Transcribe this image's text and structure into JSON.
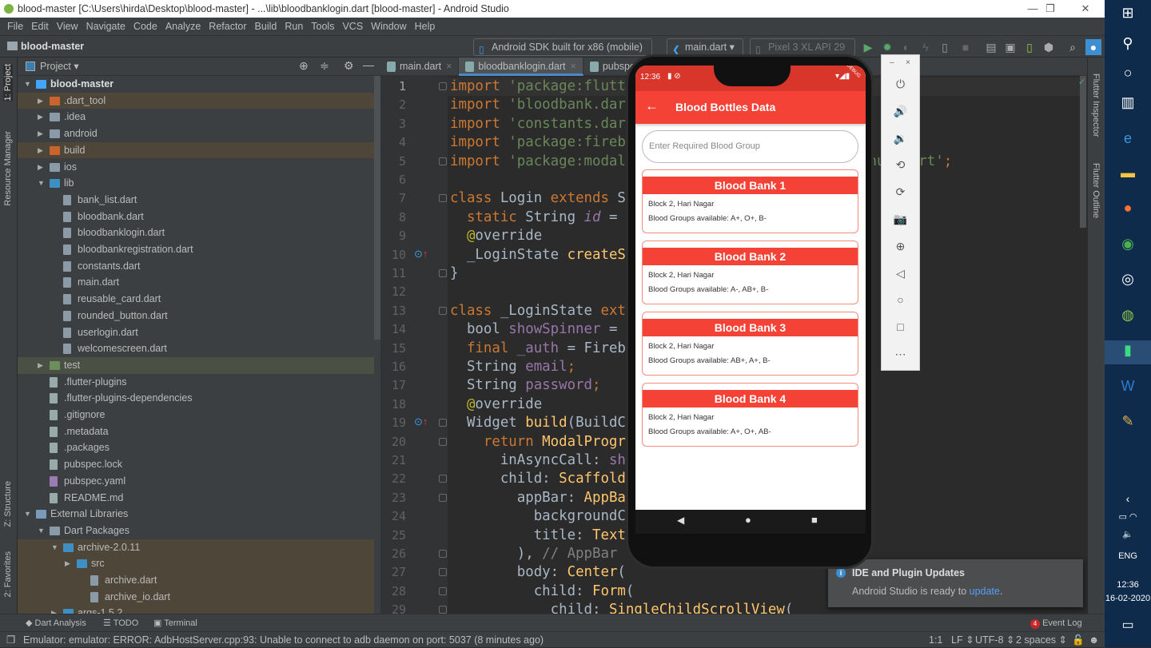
{
  "window": {
    "title": "blood-master [C:\\Users\\hirda\\Desktop\\blood-master] - ...\\lib\\bloodbanklogin.dart [blood-master] - Android Studio",
    "controls": [
      "—",
      "❐",
      "✕"
    ]
  },
  "menu": [
    "File",
    "Edit",
    "View",
    "Navigate",
    "Code",
    "Analyze",
    "Refactor",
    "Build",
    "Run",
    "Tools",
    "VCS",
    "Window",
    "Help"
  ],
  "nav": {
    "project": "blood-master",
    "device": "Android SDK built for x86 (mobile)",
    "run_config": "main.dart",
    "avd": "Pixel 3 XL API 29"
  },
  "left_stripe": [
    "1: Project",
    "Resource Manager",
    "Z: Structure",
    "2: Favorites"
  ],
  "right_stripe": [
    "Flutter Inspector",
    "Flutter Outline"
  ],
  "project_panel": {
    "title": "Project",
    "root_path": "C:\\Users\\hirda\\Desktop\\blood-master",
    "tree": [
      {
        "label": "blood-master",
        "indent": 0,
        "expanded": true,
        "icon": "flutter-module"
      },
      {
        "label": ".dart_tool",
        "indent": 1,
        "expanded": false,
        "icon": "folder-excluded",
        "hl": "brown"
      },
      {
        "label": ".idea",
        "indent": 1,
        "expanded": false,
        "icon": "folder-config"
      },
      {
        "label": "android",
        "indent": 1,
        "expanded": false,
        "icon": "folder-module"
      },
      {
        "label": "build",
        "indent": 1,
        "expanded": false,
        "icon": "folder-excluded",
        "hl": "brown"
      },
      {
        "label": "ios",
        "indent": 1,
        "expanded": false,
        "icon": "folder-module"
      },
      {
        "label": "lib",
        "indent": 1,
        "expanded": true,
        "icon": "folder-source"
      },
      {
        "label": "bank_list.dart",
        "indent": 2,
        "icon": "dart-file"
      },
      {
        "label": "bloodbank.dart",
        "indent": 2,
        "icon": "dart-file"
      },
      {
        "label": "bloodbanklogin.dart",
        "indent": 2,
        "icon": "dart-file"
      },
      {
        "label": "bloodbankregistration.dart",
        "indent": 2,
        "icon": "dart-file"
      },
      {
        "label": "constants.dart",
        "indent": 2,
        "icon": "dart-file"
      },
      {
        "label": "main.dart",
        "indent": 2,
        "icon": "dart-file"
      },
      {
        "label": "reusable_card.dart",
        "indent": 2,
        "icon": "dart-file"
      },
      {
        "label": "rounded_button.dart",
        "indent": 2,
        "icon": "dart-file"
      },
      {
        "label": "userlogin.dart",
        "indent": 2,
        "icon": "dart-file"
      },
      {
        "label": "welcomescreen.dart",
        "indent": 2,
        "icon": "dart-file"
      },
      {
        "label": "test",
        "indent": 1,
        "expanded": false,
        "icon": "folder-test",
        "hl": "green"
      },
      {
        "label": ".flutter-plugins",
        "indent": 1,
        "icon": "file"
      },
      {
        "label": ".flutter-plugins-dependencies",
        "indent": 1,
        "icon": "file"
      },
      {
        "label": ".gitignore",
        "indent": 1,
        "icon": "file"
      },
      {
        "label": ".metadata",
        "indent": 1,
        "icon": "file"
      },
      {
        "label": ".packages",
        "indent": 1,
        "icon": "file"
      },
      {
        "label": "pubspec.lock",
        "indent": 1,
        "icon": "file"
      },
      {
        "label": "pubspec.yaml",
        "indent": 1,
        "icon": "yaml-file"
      },
      {
        "label": "README.md",
        "indent": 1,
        "icon": "file"
      },
      {
        "label": "External Libraries",
        "indent": 0,
        "expanded": true,
        "icon": "library"
      },
      {
        "label": "Dart Packages",
        "indent": 1,
        "expanded": true,
        "icon": "folder"
      },
      {
        "label": "archive-2.0.11",
        "indent": 2,
        "expanded": true,
        "icon": "folder-source",
        "hl": "brown"
      },
      {
        "label": "src",
        "indent": 3,
        "expanded": false,
        "icon": "folder-source",
        "hl": "brown"
      },
      {
        "label": "archive.dart",
        "indent": 4,
        "icon": "dart-file",
        "hl": "brown"
      },
      {
        "label": "archive_io.dart",
        "indent": 4,
        "icon": "dart-file",
        "hl": "brown"
      },
      {
        "label": "args-1.5.2",
        "indent": 2,
        "expanded": false,
        "icon": "folder-source",
        "hl": "brown"
      }
    ]
  },
  "editor": {
    "tabs": [
      {
        "label": "main.dart",
        "active": false
      },
      {
        "label": "bloodbanklogin.dart",
        "active": true
      },
      {
        "label": "pubspec.yaml",
        "active": false
      }
    ],
    "current_line": 1,
    "lines": [
      [
        [
          "import ",
          "k"
        ],
        [
          "'package:flutt",
          "s"
        ]
      ],
      [
        [
          "import ",
          "k"
        ],
        [
          "'bloodbank.dar",
          "s"
        ]
      ],
      [
        [
          "import ",
          "k"
        ],
        [
          "'constants.dar",
          "s"
        ]
      ],
      [
        [
          "import ",
          "k"
        ],
        [
          "'package:fireb",
          "s"
        ]
      ],
      [
        [
          "import ",
          "k"
        ],
        [
          "'package:modal_progress_hud/modal_progress_hud.dart'",
          "s"
        ],
        [
          ";",
          "k"
        ]
      ],
      [],
      [
        [
          "class ",
          "k"
        ],
        [
          "Login ",
          "d"
        ],
        [
          "extends ",
          "k"
        ],
        [
          "S",
          "d"
        ]
      ],
      [
        [
          "  static ",
          "k"
        ],
        [
          "String ",
          "d"
        ],
        [
          "id",
          "fi2"
        ],
        [
          " =",
          "d"
        ]
      ],
      [
        [
          "  @",
          "a"
        ],
        [
          "override",
          "d"
        ]
      ],
      [
        [
          "  _LoginState ",
          "d"
        ],
        [
          "createS",
          "fn"
        ]
      ],
      [
        [
          "}",
          "d"
        ]
      ],
      [],
      [
        [
          "class ",
          "k"
        ],
        [
          "_LoginState ",
          "d"
        ],
        [
          "ext",
          "k"
        ]
      ],
      [
        [
          "  bool ",
          "d"
        ],
        [
          "showSpinner",
          "f"
        ],
        [
          " =",
          "d"
        ]
      ],
      [
        [
          "  final ",
          "k"
        ],
        [
          "_auth",
          "f"
        ],
        [
          " = Fireb",
          "d"
        ]
      ],
      [
        [
          "  String ",
          "d"
        ],
        [
          "email",
          "f"
        ],
        [
          ";",
          "k"
        ]
      ],
      [
        [
          "  String ",
          "d"
        ],
        [
          "password",
          "f"
        ],
        [
          ";",
          "k"
        ]
      ],
      [
        [
          "  @",
          "a"
        ],
        [
          "override",
          "d"
        ]
      ],
      [
        [
          "  Widget ",
          "d"
        ],
        [
          "build",
          "fn"
        ],
        [
          "(BuildC",
          "d"
        ]
      ],
      [
        [
          "    return ",
          "k"
        ],
        [
          "ModalProgr",
          "fn"
        ]
      ],
      [
        [
          "      inAsyncCall: ",
          "d"
        ],
        [
          "sh",
          "f"
        ]
      ],
      [
        [
          "      child: ",
          "d"
        ],
        [
          "Scaffold",
          "fn"
        ]
      ],
      [
        [
          "        appBar: ",
          "d"
        ],
        [
          "AppBa",
          "fn"
        ]
      ],
      [
        [
          "          backgroundC",
          "d"
        ]
      ],
      [
        [
          "          title: ",
          "d"
        ],
        [
          "Text",
          "fn"
        ]
      ],
      [
        [
          "        ), ",
          "d"
        ],
        [
          "// AppBar",
          "c"
        ]
      ],
      [
        [
          "        body: ",
          "d"
        ],
        [
          "Center",
          "fn"
        ],
        [
          "(",
          "d"
        ]
      ],
      [
        [
          "          child: ",
          "d"
        ],
        [
          "Form",
          "fn"
        ],
        [
          "(",
          "d"
        ]
      ],
      [
        [
          "            child: ",
          "d"
        ],
        [
          "SingleChildScrollView",
          "fn"
        ],
        [
          "(",
          "d"
        ]
      ]
    ],
    "override_markers": [
      10,
      19
    ]
  },
  "bottom_tools": [
    "Dart Analysis",
    "TODO",
    "Terminal"
  ],
  "event_log": {
    "label": "Event Log",
    "count": "4"
  },
  "status": {
    "message": "Emulator: emulator: ERROR: AdbHostServer.cpp:93: Unable to connect to adb daemon on port: 5037 (8 minutes ago)",
    "position": "1:1",
    "line_sep": "LF",
    "encoding": "UTF-8",
    "indent": "2 spaces"
  },
  "notification": {
    "title": "IDE and Plugin Updates",
    "text": "Android Studio is ready to ",
    "link": "update",
    "tail": "."
  },
  "phone": {
    "time": "12:36",
    "debug": "DEBUG",
    "appbar_title": "Blood Bottles Data",
    "search_placeholder": "Enter Required Blood Group",
    "accent": "#f44336",
    "cards": [
      {
        "name": "Blood Bank 1",
        "address": "Block 2, Hari Nagar",
        "groups": "Blood Groups available: A+, O+, B-"
      },
      {
        "name": "Blood Bank 2",
        "address": "Block 2, Hari Nagar",
        "groups": "Blood Groups available: A-, AB+, B-"
      },
      {
        "name": "Blood Bank 3",
        "address": "Block 2, Hari Nagar",
        "groups": "Blood Groups available: AB+, A+, B-"
      },
      {
        "name": "Blood Bank 4",
        "address": "Block 2, Hari Nagar",
        "groups": "Blood Groups available: A+, O+, AB-"
      }
    ]
  },
  "emulator_tools": [
    "power-icon",
    "volume-up-icon",
    "volume-down-icon",
    "rotate-left-icon",
    "rotate-right-icon",
    "camera-icon",
    "zoom-icon",
    "back-icon",
    "home-icon",
    "overview-icon",
    "more-icon"
  ],
  "taskbar": {
    "apps": [
      "windows-start",
      "search",
      "cortana",
      "task-view",
      "edge",
      "file-explorer",
      "firefox",
      "chrome",
      "app",
      "android-studio",
      "active-app",
      "word",
      "paint"
    ],
    "lang": "ENG",
    "time": "12:36",
    "date": "16-02-2020"
  }
}
